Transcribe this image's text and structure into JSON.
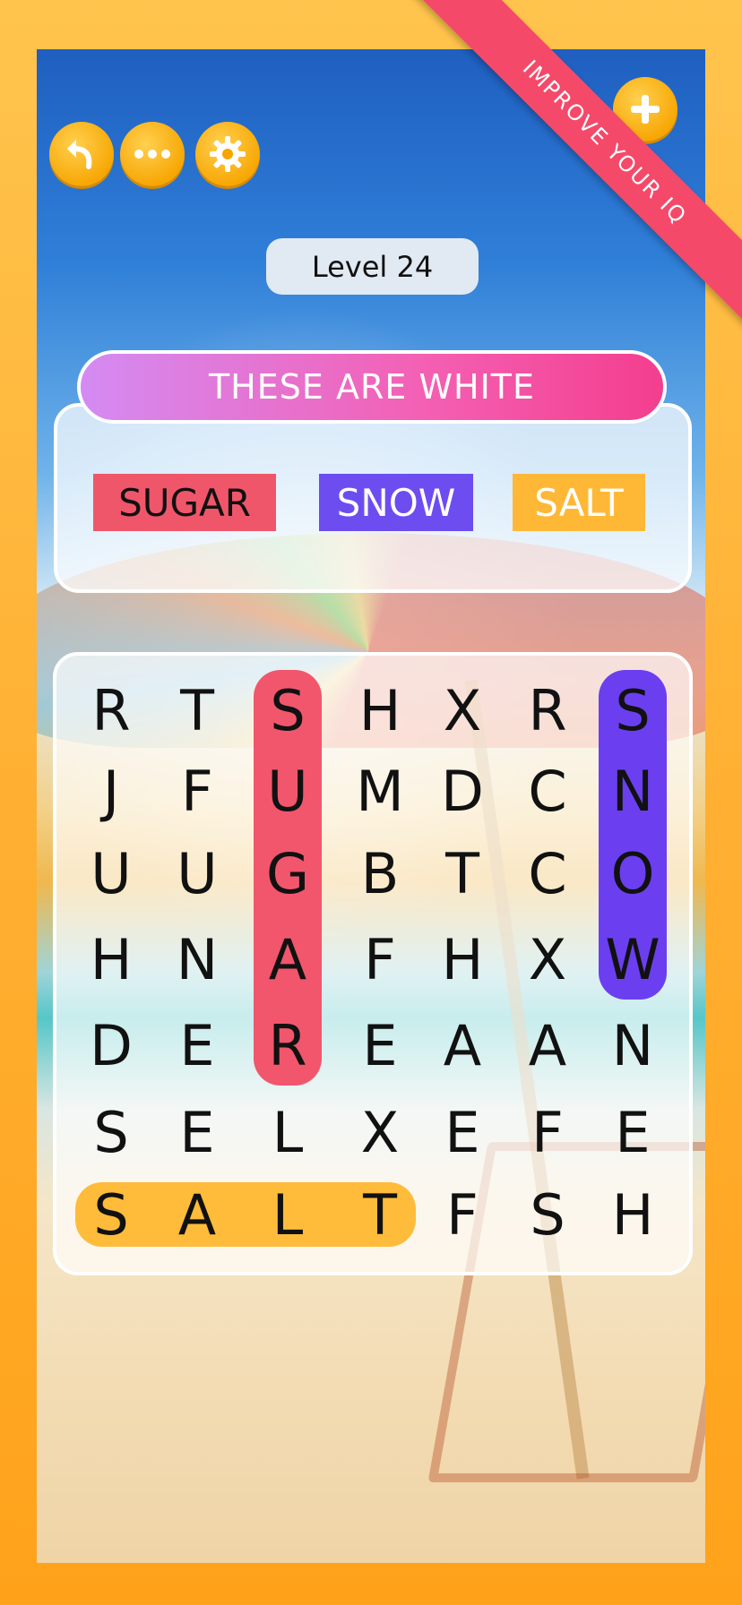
{
  "ribbon_text": "IMPROVE YOUR IQ",
  "level_label": "Level 24",
  "hint": "THESE ARE WHITE",
  "found_words": [
    {
      "text": "SUGAR",
      "color": "#f0566a",
      "text_color": "#111111"
    },
    {
      "text": "SNOW",
      "color": "#6d4df0",
      "text_color": "#ffffff"
    },
    {
      "text": "SALT",
      "color": "#ffb836",
      "text_color": "#ffffff"
    }
  ],
  "grid": [
    [
      "R",
      "T",
      "S",
      "H",
      "X",
      "R",
      "S"
    ],
    [
      "J",
      "F",
      "U",
      "M",
      "D",
      "C",
      "N"
    ],
    [
      "U",
      "U",
      "G",
      "B",
      "T",
      "C",
      "O"
    ],
    [
      "H",
      "N",
      "A",
      "F",
      "H",
      "X",
      "W"
    ],
    [
      "D",
      "E",
      "R",
      "E",
      "A",
      "A",
      "N"
    ],
    [
      "S",
      "E",
      "L",
      "X",
      "E",
      "F",
      "E"
    ],
    [
      "S",
      "A",
      "L",
      "T",
      "F",
      "S",
      "H"
    ]
  ],
  "highlights": [
    {
      "word": "SUGAR",
      "col": 2,
      "row_start": 0,
      "row_end": 4,
      "direction": "vertical",
      "color": "#f2566c"
    },
    {
      "word": "SNOW",
      "col": 6,
      "row_start": 0,
      "row_end": 3,
      "direction": "vertical",
      "color": "#6b3ff0"
    },
    {
      "word": "SALT",
      "row": 6,
      "col_start": 0,
      "col_end": 3,
      "direction": "horizontal",
      "color": "#ffbb3a"
    }
  ],
  "colors": {
    "accent_orange": "#f7a500",
    "ribbon": "#f5496a",
    "hint_gradient_start": "#d48bf3",
    "hint_gradient_end": "#f43e8e"
  },
  "icons": {
    "back": "undo-arrow-icon",
    "more": "ellipsis-icon",
    "settings": "gear-icon",
    "add": "plus-icon"
  }
}
